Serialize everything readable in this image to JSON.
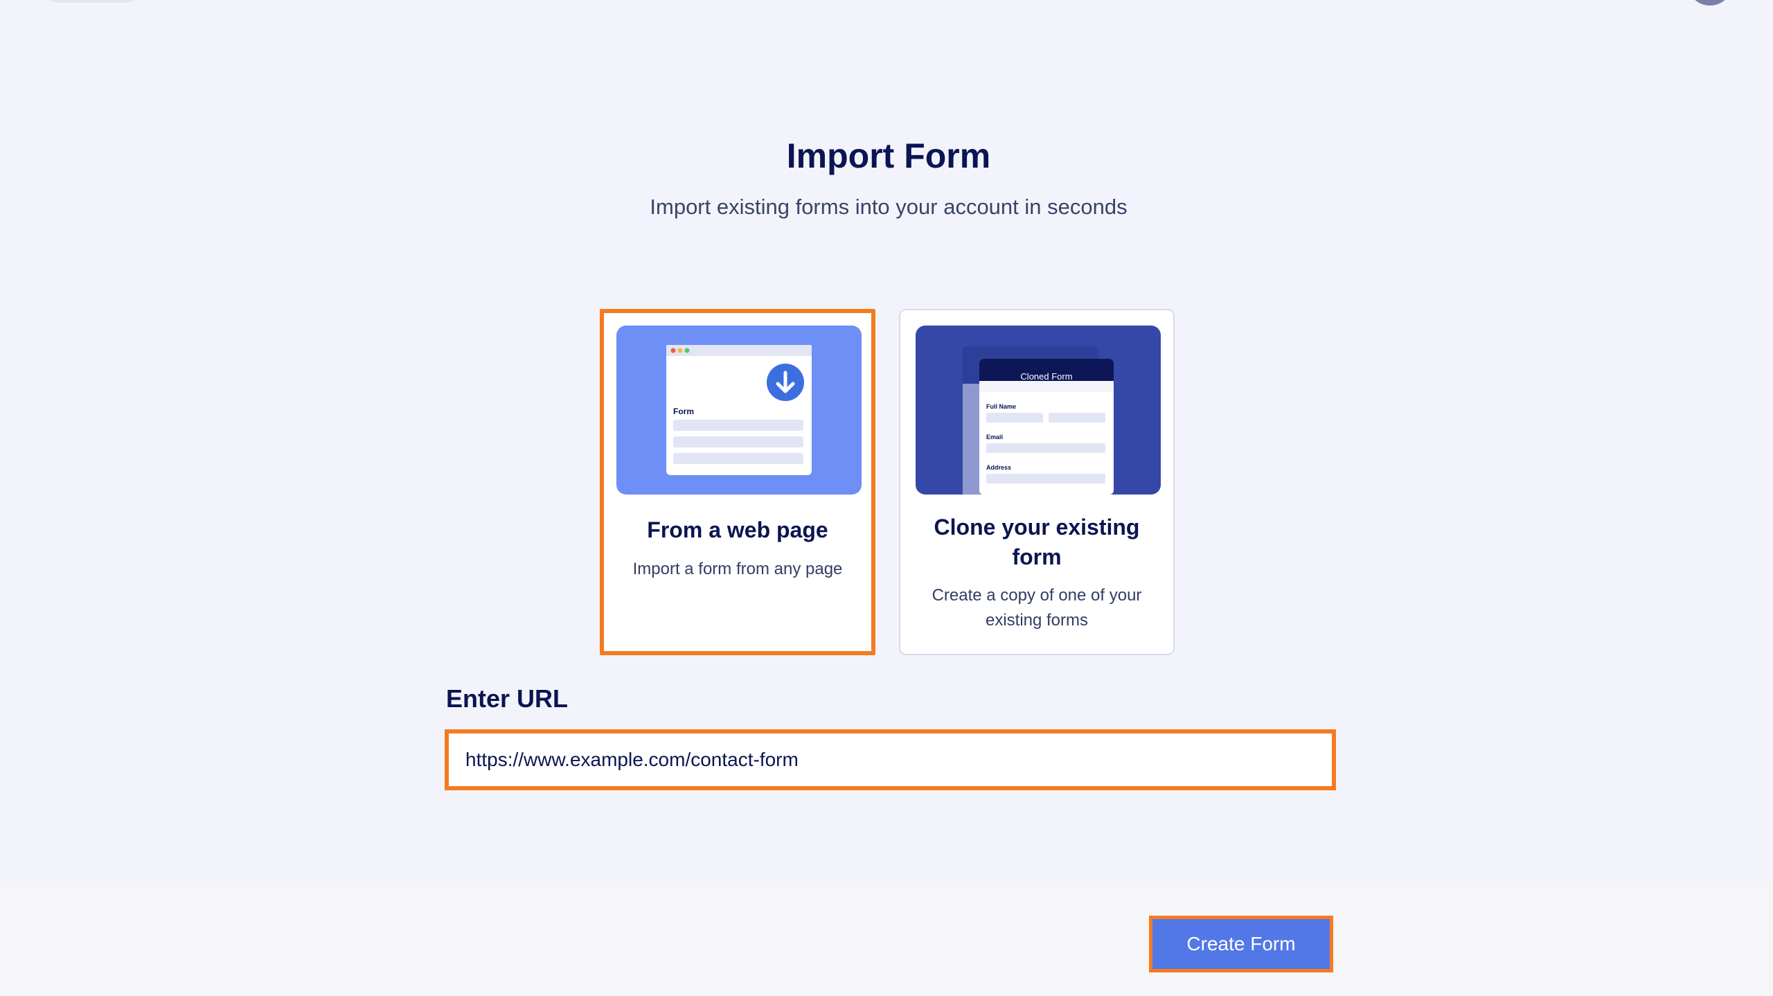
{
  "header": {
    "title": "Import Form",
    "subtitle": "Import existing forms into your account in seconds"
  },
  "options": [
    {
      "title": "From a web page",
      "description": "Import a form from any page",
      "selected": true,
      "illustration": {
        "icon": "download-arrow-icon",
        "form_label": "Form"
      }
    },
    {
      "title": "Clone your existing form",
      "description": "Create a copy of one of your existing forms",
      "selected": false,
      "illustration": {
        "header": "Cloned Form",
        "fields": [
          "Full Name",
          "Email",
          "Address"
        ]
      }
    }
  ],
  "url_section": {
    "label": "Enter URL",
    "value": "https://www.example.com/contact-form"
  },
  "footer": {
    "create_button": "Create Form"
  },
  "colors": {
    "accent": "#5278e8",
    "highlight": "#f47b1f",
    "text_dark": "#0a1551",
    "background": "#f3f4fb"
  }
}
